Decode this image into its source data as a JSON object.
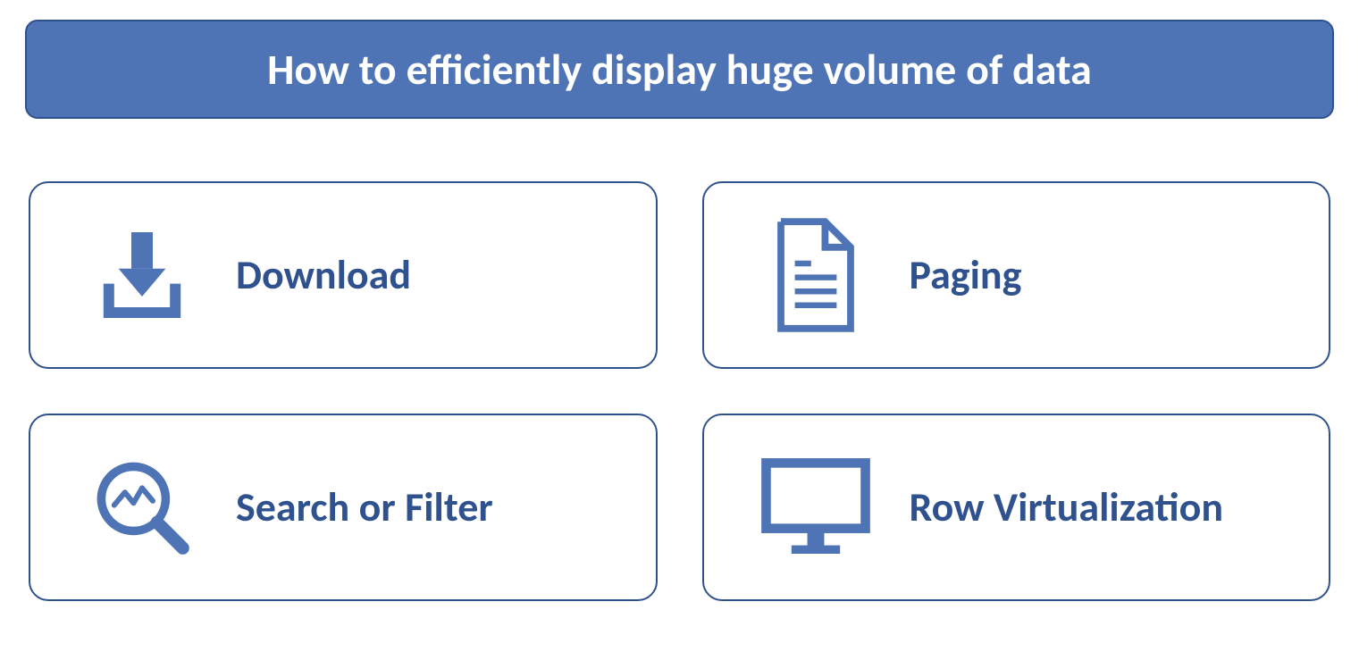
{
  "header": {
    "title": "How to efficiently display huge volume of data"
  },
  "cards": [
    {
      "icon": "download-icon",
      "label": "Download"
    },
    {
      "icon": "document-icon",
      "label": "Paging"
    },
    {
      "icon": "search-analytics-icon",
      "label": "Search or Filter"
    },
    {
      "icon": "monitor-icon",
      "label": "Row Virtualization"
    }
  ],
  "colors": {
    "primary": "#4f74b6",
    "border": "#2f528f",
    "text": "#2f528f"
  }
}
